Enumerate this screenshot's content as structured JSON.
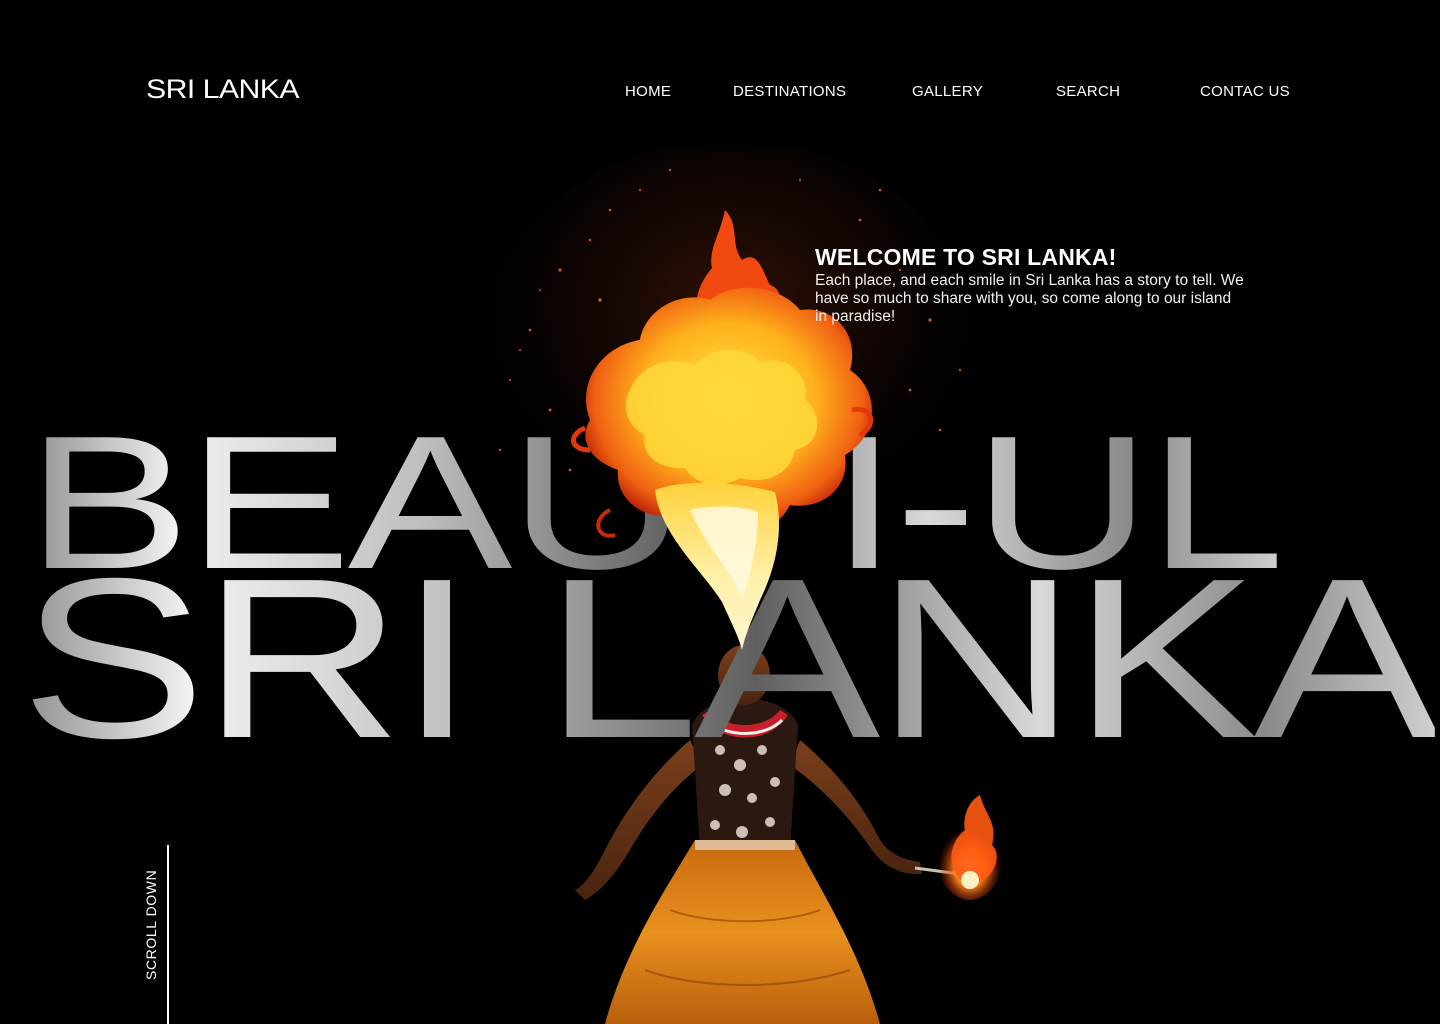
{
  "header": {
    "logo": "SRI LANKA",
    "nav": [
      {
        "label": "HOME"
      },
      {
        "label": "DESTINATIONS"
      },
      {
        "label": "GALLERY"
      },
      {
        "label": "SEARCH"
      },
      {
        "label": "CONTAC US"
      }
    ]
  },
  "hero": {
    "line1": "BEAUTI-UL",
    "line2": "SRI LANKA"
  },
  "welcome": {
    "title": "WELCOME TO SRI  LANKA!",
    "text": "Each place, and each smile in Sri Lanka has a story to tell. We have so much to share with you, so come along to our island in paradise!"
  },
  "scroll": {
    "label": "SCROLL DOWN"
  },
  "colors": {
    "background": "#000000",
    "text": "#ffffff",
    "flame_core": "#ffd84a",
    "flame_outer": "#e8410e",
    "costume": "#d8821c"
  },
  "icons": {
    "scroll_indicator": "vertical-line"
  }
}
